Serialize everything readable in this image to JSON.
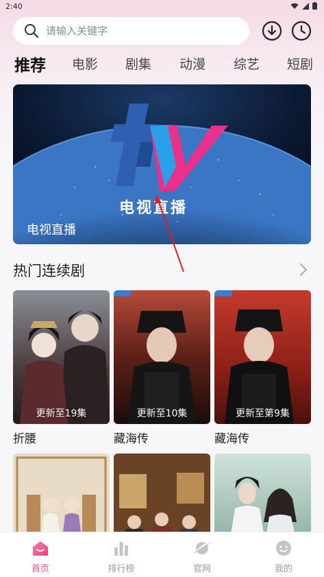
{
  "status_bar": {
    "time": "2:40",
    "icons": [
      "wifi-icon",
      "signal-icon",
      "battery-icon"
    ]
  },
  "search": {
    "placeholder": "请输入关键字",
    "icon": "search-icon"
  },
  "header_actions": {
    "download_icon": "download-icon",
    "history_icon": "history-clock-icon"
  },
  "tabs": [
    {
      "label": "推荐",
      "active": true
    },
    {
      "label": "电影",
      "active": false
    },
    {
      "label": "剧集",
      "active": false
    },
    {
      "label": "动漫",
      "active": false
    },
    {
      "label": "综艺",
      "active": false
    },
    {
      "label": "短剧",
      "active": false
    }
  ],
  "banner": {
    "logo_text": "电视直播",
    "caption": "电视直播"
  },
  "section": {
    "title": "热门连续剧",
    "more_icon": "chevron-right-icon"
  },
  "cards": [
    {
      "name": "折腰",
      "update": "更新至19集"
    },
    {
      "name": "藏海传",
      "update": "更新至10集"
    },
    {
      "name": "藏海传",
      "update": "更新至第9集"
    }
  ],
  "bottom_nav": [
    {
      "label": "首页",
      "icon": "home-icon",
      "active": true
    },
    {
      "label": "排行榜",
      "icon": "ranking-icon",
      "active": false
    },
    {
      "label": "官网",
      "icon": "planet-icon",
      "active": false
    },
    {
      "label": "我的",
      "icon": "profile-icon",
      "active": false
    }
  ],
  "colors": {
    "accent": "#ef4e8c",
    "inactive": "#9a9a9a",
    "background": "#f7f7fa"
  }
}
